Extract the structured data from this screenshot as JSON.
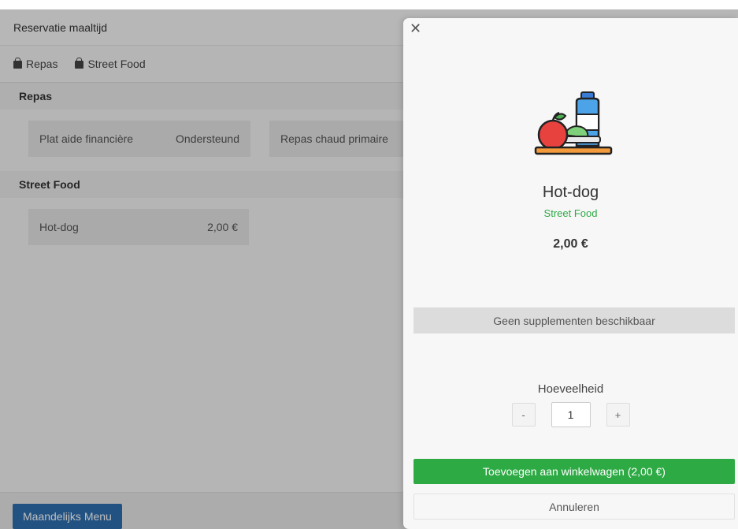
{
  "page": {
    "header_title": "Reservatie maaltijd",
    "tabs": [
      {
        "label": "Repas",
        "icon": "shopping-bag-icon"
      },
      {
        "label": "Street Food",
        "icon": "shopping-bag-icon"
      }
    ],
    "sections": [
      {
        "title": "Repas",
        "items": [
          {
            "name": "Plat aide financière",
            "price": "Ondersteund"
          },
          {
            "name": "Repas chaud primaire",
            "price": ""
          }
        ]
      },
      {
        "title": "Street Food",
        "items": [
          {
            "name": "Hot-dog",
            "price": "2,00 €"
          }
        ]
      }
    ],
    "footer_button": "Maandelijks Menu"
  },
  "modal": {
    "close_icon": "close-icon",
    "image_icon": "food-tray-icon",
    "product_name": "Hot-dog",
    "category": "Street Food",
    "price": "2,00 €",
    "supplements_text": "Geen supplementen beschikbaar",
    "quantity_label": "Hoeveelheid",
    "quantity_minus": "-",
    "quantity_value": "1",
    "quantity_plus": "+",
    "add_button": "Toevoegen aan winkelwagen (2,00 €)",
    "cancel_button": "Annuleren"
  },
  "colors": {
    "accent_green": "#2eaa45",
    "primary_blue": "#2f6fb0"
  }
}
